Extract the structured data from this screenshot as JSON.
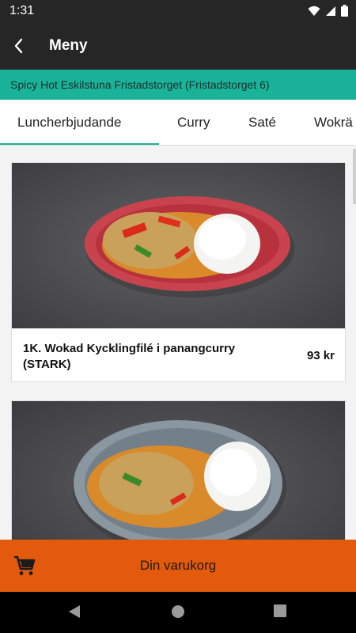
{
  "status_bar": {
    "time": "1:31",
    "icons": [
      "wifi-icon",
      "signal-icon",
      "battery-icon"
    ]
  },
  "app_bar": {
    "title": "Meny",
    "back_icon": "back-arrow-icon"
  },
  "location": {
    "text": "Spicy Hot Eskilstuna Fristadstorget (Fristadstorget 6)"
  },
  "tabs": [
    {
      "label": "Luncherbjudande",
      "active": true
    },
    {
      "label": "Curry",
      "active": false
    },
    {
      "label": "Saté",
      "active": false
    },
    {
      "label": "Wokrä",
      "active": false
    }
  ],
  "menu_items": [
    {
      "name": "1K. Wokad Kycklingfilé i panangcurry (STARK)",
      "price": "93 kr",
      "plate_color": "red"
    },
    {
      "name": "",
      "price": "",
      "plate_color": "grey"
    }
  ],
  "cart": {
    "label": "Din varukorg",
    "icon": "shopping-cart-icon"
  },
  "colors": {
    "accent": "#1ab39a",
    "cart": "#e35a0c",
    "app_bar": "#262626"
  }
}
